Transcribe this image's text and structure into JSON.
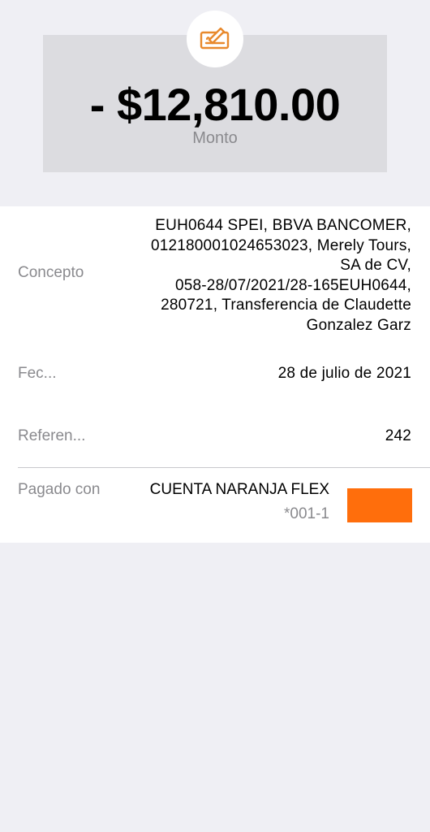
{
  "summary": {
    "icon": "check-edit-icon",
    "amount": "- $12,810.00",
    "amount_label": "Monto"
  },
  "details": {
    "concepto": {
      "label": "Concepto",
      "lines": [
        "EUH0644 SPEI, BBVA BANCOMER,",
        "012180001024653023, Merely Tours,",
        "SA de CV,",
        "058-28/07/2021/28-165EUH0644,",
        "280721, Transferencia de Claudette",
        "Gonzalez Garz"
      ]
    },
    "fecha": {
      "label": "Fec...",
      "value": "28 de julio de 2021"
    },
    "referencia": {
      "label": "Referen...",
      "value": "242"
    },
    "pagado_con": {
      "label": "Pagado con",
      "account_name": "CUENTA NARANJA FLEX",
      "account_number": "*001-1",
      "card_color": "#ff6e0c"
    }
  },
  "colors": {
    "accent": "#e8892c",
    "background": "#efeff4",
    "card": "#dcdce0",
    "secondary_text": "#8a8a8e"
  }
}
